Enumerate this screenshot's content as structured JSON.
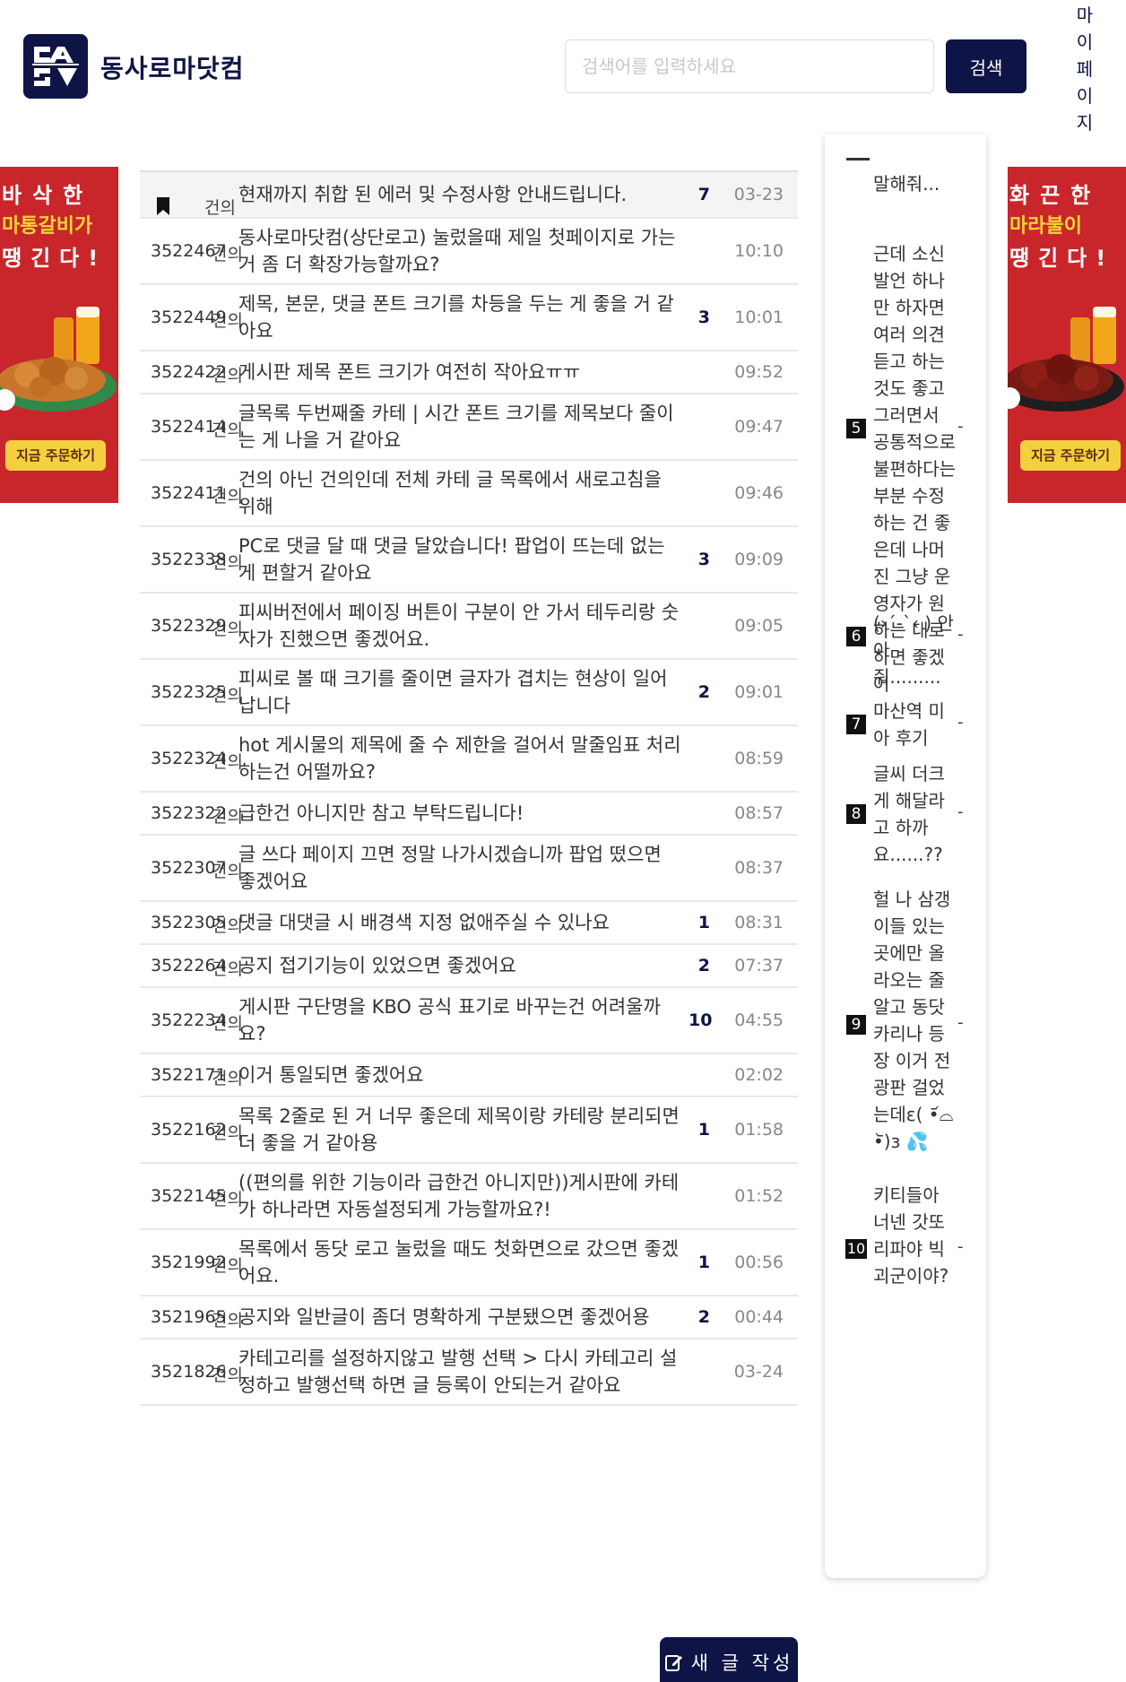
{
  "header": {
    "site_name": "동사로마닷컴",
    "search_placeholder": "검색어를 입력하세요",
    "search_button": "검색",
    "mypage": "마이페이지"
  },
  "ads": {
    "left": {
      "line1": "바삭한",
      "line2": "마통갈비가",
      "line3": "땡긴다!",
      "cta": "지금 주문하기"
    },
    "right": {
      "line1": "화끈한",
      "line2": "마라불이",
      "line3": "땡긴다!",
      "cta": "지금 주문하기"
    }
  },
  "board": {
    "notice": {
      "category": "건의",
      "title": "현재까지 취합 된 에러 및 수정사항 안내드립니다.",
      "comments": "7",
      "time": "03-23"
    },
    "rows": [
      {
        "num": "3522467",
        "category": "건의",
        "title": "동사로마닷컴(상단로고) 눌렀을때 제일 첫페이지로 가는거 좀 더 확장가능할까요?",
        "comments": "",
        "time": "10:10"
      },
      {
        "num": "3522449",
        "category": "건의",
        "title": "제목, 본문, 댓글 폰트 크기를 차등을 두는 게 좋을 거 같아요",
        "comments": "3",
        "time": "10:01"
      },
      {
        "num": "3522422",
        "category": "건의",
        "title": "게시판 제목 폰트 크기가 여전히 작아요ㅠㅠ",
        "comments": "",
        "time": "09:52"
      },
      {
        "num": "3522414",
        "category": "건의",
        "title": "글목록 두번째줄 카테 | 시간 폰트 크기를 제목보다 줄이는 게 나을 거 같아요",
        "comments": "",
        "time": "09:47"
      },
      {
        "num": "3522411",
        "category": "건의",
        "title": "건의 아닌 건의인데 전체 카테 글 목록에서 새로고침을 위해",
        "comments": "",
        "time": "09:46"
      },
      {
        "num": "3522338",
        "category": "건의",
        "title": "PC로 댓글 달 때 댓글 달았습니다! 팝업이 뜨는데 없는게 편할거 같아요",
        "comments": "3",
        "time": "09:09"
      },
      {
        "num": "3522329",
        "category": "건의",
        "title": "피씨버전에서 페이징 버튼이 구분이 안 가서 테두리랑 숫자가 진했으면 좋겠어요.",
        "comments": "",
        "time": "09:05"
      },
      {
        "num": "3522325",
        "category": "건의",
        "title": "피씨로 볼 때 크기를 줄이면 글자가 겹치는 현상이 일어납니다",
        "comments": "2",
        "time": "09:01"
      },
      {
        "num": "3522324",
        "category": "건의",
        "title": "hot 게시물의 제목에 줄 수 제한을 걸어서 말줄임표 처리하는건 어떨까요?",
        "comments": "",
        "time": "08:59"
      },
      {
        "num": "3522322",
        "category": "건의",
        "title": "급한건 아니지만 참고 부탁드립니다!",
        "comments": "",
        "time": "08:57"
      },
      {
        "num": "3522307",
        "category": "건의",
        "title": "글 쓰다 페이지 끄면 정말 나가시겠습니까 팝업 떴으면 좋겠어요",
        "comments": "",
        "time": "08:37"
      },
      {
        "num": "3522305",
        "category": "건의",
        "title": "댓글 대댓글 시 배경색 지정 없애주실 수 있나요",
        "comments": "1",
        "time": "08:31"
      },
      {
        "num": "3522264",
        "category": "건의",
        "title": "공지 접기기능이 있었으면 좋겠어요",
        "comments": "2",
        "time": "07:37"
      },
      {
        "num": "3522234",
        "category": "건의",
        "title": "게시판 구단명을 KBO 공식 표기로 바꾸는건 어려울까요?",
        "comments": "10",
        "time": "04:55"
      },
      {
        "num": "3522171",
        "category": "건의",
        "title": "이거 통일되면 좋겠어요",
        "comments": "",
        "time": "02:02"
      },
      {
        "num": "3522162",
        "category": "건의",
        "title": "목록 2줄로 된 거 너무 좋은데 제목이랑 카테랑 분리되면 더 좋을 거 같아용",
        "comments": "1",
        "time": "01:58"
      },
      {
        "num": "3522145",
        "category": "건의",
        "title": "((편의를 위한 기능이라 급한건 아니지만))게시판에 카테가 하나라면 자동설정되게 가능할까요?!",
        "comments": "",
        "time": "01:52"
      },
      {
        "num": "3521992",
        "category": "건의",
        "title": "목록에서 동닷 로고 눌렀을 때도 첫화면으로 갔으면 좋겠어요.",
        "comments": "1",
        "time": "00:56"
      },
      {
        "num": "3521965",
        "category": "건의",
        "title": "공지와 일반글이 좀더 명확하게 구분됐으면 좋겠어용",
        "comments": "2",
        "time": "00:44"
      },
      {
        "num": "3521826",
        "category": "건의",
        "title": "카테고리를 설정하지않고 발행 선택 > 다시 카테고리 설정하고 발행선택 하면 글 등록이 안되는거 같아요",
        "comments": "",
        "time": "03-24"
      }
    ],
    "write_button": "새 글 작성"
  },
  "sidebar": {
    "top_text": "말해줘...",
    "items": [
      {
        "rank": "5",
        "text": "근데 소신발언 하나만 하자면 여러 의견 듣고 하는 것도 좋고 그러면서 공통적으로 불편하다는 부분 수정하는 건 좋은데 나머진 그냥 운영자가 원하는 대로 하면 좋겠어",
        "dash": "-"
      },
      {
        "rank": "6",
        "text": "(›´-`‹ ) 안아줘.........",
        "dash": "-"
      },
      {
        "rank": "7",
        "text": "마산역 미아 후기",
        "dash": "-"
      },
      {
        "rank": "8",
        "text": "글씨 더크게 해달라고 하까요......??",
        "dash": "-"
      },
      {
        "rank": "9",
        "text": "헐 나 삼갱이들 있는 곳에만 올라오는 줄 알고 동닷 카리나 등장 이거 전광판 걸었는데ε( •᷄⌓•᷅)з 💦",
        "dash": "-"
      },
      {
        "rank": "10",
        "text": "키티들아 너넨 갓또리파야 빅괴군이야?",
        "dash": "-"
      }
    ]
  }
}
